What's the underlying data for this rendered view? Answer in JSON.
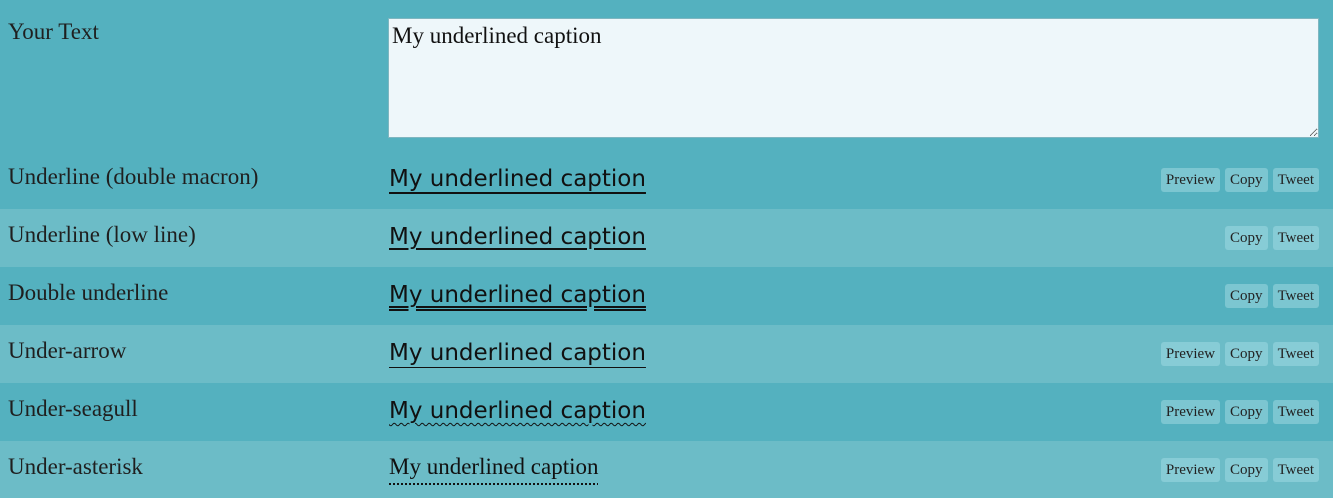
{
  "input": {
    "label": "Your Text",
    "value": "My underlined caption"
  },
  "buttons": {
    "preview": "Preview",
    "copy": "Copy",
    "tweet": "Tweet"
  },
  "rows": [
    {
      "label": "Underline (double macron)",
      "output": "My underlined caption",
      "has_preview": true
    },
    {
      "label": "Underline (low line)",
      "output": "My underlined caption",
      "has_preview": false
    },
    {
      "label": "Double underline",
      "output": "My underlined caption",
      "has_preview": false
    },
    {
      "label": "Under-arrow",
      "output": "My underlined caption",
      "has_preview": true
    },
    {
      "label": "Under-seagull",
      "output": "My underlined caption",
      "has_preview": true
    },
    {
      "label": "Under-asterisk",
      "output": "My underlined caption",
      "has_preview": true
    }
  ],
  "colors": {
    "background": "#54b1bf",
    "alt_row": "#6cbcc7",
    "textarea_bg": "#eef7fa",
    "button_bg": "#7cc6d1"
  }
}
